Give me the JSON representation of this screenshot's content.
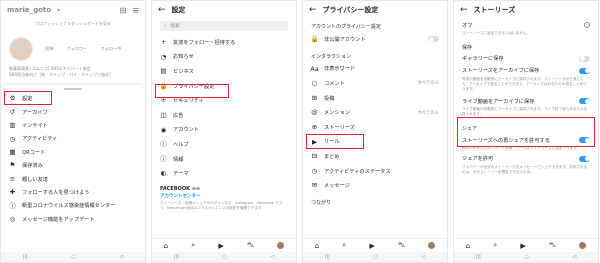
{
  "p1": {
    "username": "marie_goto",
    "pro_link": "プロフェッショナルダッシュボードを見る",
    "stats": [
      "投稿",
      "フォロワー",
      "フォロー中"
    ],
    "bio": "後藤真理恵 [コムニコ] SNSエキスパート協会",
    "bio2": "SNS担当者向け［新・ステップ・バイ・ステップで始め］",
    "menu": [
      {
        "icon": "⚙",
        "label": "設定"
      },
      {
        "icon": "↺",
        "label": "アーカイブ"
      },
      {
        "icon": "▥",
        "label": "インサイト"
      },
      {
        "icon": "◷",
        "label": "アクティビティ"
      },
      {
        "icon": "▦",
        "label": "QRコード"
      },
      {
        "icon": "⚑",
        "label": "保存済み"
      },
      {
        "icon": "≡",
        "label": "親しい友達"
      },
      {
        "icon": "✚",
        "label": "フォローする人を見つけよう"
      },
      {
        "icon": "ⓘ",
        "label": "新型コロナウイルス感染症情報センター"
      },
      {
        "icon": "◎",
        "label": "メッセージ機能をアップデート"
      }
    ]
  },
  "p2": {
    "title": "設定",
    "search_placeholder": "検索",
    "menu": [
      {
        "icon": "+",
        "label": "友達をフォロー・招待する"
      },
      {
        "icon": "◔",
        "label": "お知らせ"
      },
      {
        "icon": "▤",
        "label": "ビジネス"
      },
      {
        "icon": "🔒",
        "label": "プライバシー設定"
      },
      {
        "icon": "⛨",
        "label": "セキュリティ"
      },
      {
        "icon": "◫",
        "label": "広告"
      },
      {
        "icon": "◉",
        "label": "アカウント"
      },
      {
        "icon": "ⓘ",
        "label": "ヘルプ"
      },
      {
        "icon": "ⓘ",
        "label": "情報"
      },
      {
        "icon": "◐",
        "label": "テーマ"
      }
    ],
    "fb_title": "FACEBOOK ∞∞",
    "fb_link": "アカウントセンター",
    "fb_desc": "ストーリーズ・投稿のシェアやログインなど、Instagram、Facebook アプリ、Messenger全体のエクスペリエンスの設定を管理できます。"
  },
  "p3": {
    "title": "プライバシー設定",
    "section1": "アカウントのプライバシー設定",
    "private_label": "非公開アカウント",
    "section2": "インタラクション",
    "menu": [
      {
        "icon": "Aa",
        "label": "非表示ワード",
        "val": ""
      },
      {
        "icon": "○",
        "label": "コメント",
        "val": "すべての人"
      },
      {
        "icon": "⊞",
        "label": "投稿",
        "val": ""
      },
      {
        "icon": "@",
        "label": "メンション",
        "val": "すべての人"
      },
      {
        "icon": "⊕",
        "label": "ストーリーズ",
        "val": ""
      },
      {
        "icon": "▶",
        "label": "リール",
        "val": ""
      },
      {
        "icon": "⊟",
        "label": "まとめ",
        "val": ""
      },
      {
        "icon": "◷",
        "label": "アクティビティのステータス",
        "val": ""
      },
      {
        "icon": "✉",
        "label": "メッセージ",
        "val": ""
      }
    ],
    "section3": "つながり"
  },
  "p4": {
    "title": "ストーリーズ",
    "off_label": "オフ",
    "off_desc": "ストーリーズに返信できる人はいません。",
    "save_section": "保存",
    "gallery_label": "ギャラリーに保存",
    "archive_label": "ストーリーズをアーカイブに保存",
    "archive_desc": "写真や動画を自動的にアーカイブに保存されます。ストーリーズから消えても、アーカイブで見ることができます。アーカイブはあなたのみ見ることができます。",
    "live_label": "ライブ動画をアーカイブに保存",
    "live_desc": "ライブ動画が自動的にアーカイブに保存されます。ライブ終了後もあなたのみ見られます。",
    "share_section": "シェア",
    "reshare_label": "ストーリーズへの再シェアを許可する",
    "reshare_desc": "他の人があなたのフィード投稿・リールをストーリーズに追加できます。",
    "share_label": "シェアを許可",
    "share_desc": "フォロワーが自分のストーリーズをメッセージでシェアできます。共有されるのは、そのストーリーを閲覧できる人のみ。"
  },
  "nav": {
    "home": "⌂",
    "search": "⌕",
    "reels": "▶",
    "shop": "⛍",
    "back": "◁",
    "circle": "○",
    "square": "▢"
  }
}
